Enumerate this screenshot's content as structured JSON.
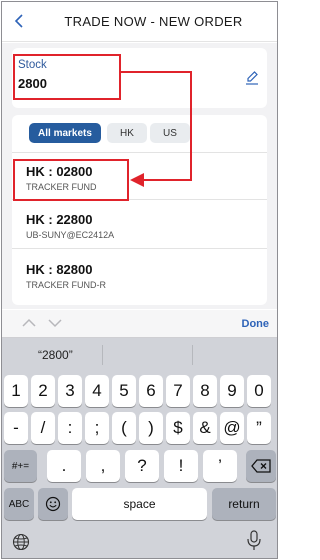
{
  "header": {
    "title": "TRADE NOW - NEW ORDER",
    "back_icon": "chevron-left-icon"
  },
  "stock_field": {
    "label": "Stock",
    "value": "2800",
    "edit_icon": "pencil-icon"
  },
  "market_filter": {
    "options": [
      "All markets",
      "HK",
      "US"
    ],
    "selected": "All markets"
  },
  "results": [
    {
      "code": "HK : 02800",
      "name": "TRACKER FUND"
    },
    {
      "code": "HK : 22800",
      "name": "UB-SUNY@EC2412A"
    },
    {
      "code": "HK : 82800",
      "name": "TRACKER FUND-R"
    }
  ],
  "keyboard": {
    "done_label": "Done",
    "suggestion": "“2800”",
    "row1": [
      "1",
      "2",
      "3",
      "4",
      "5",
      "6",
      "7",
      "8",
      "9",
      "0"
    ],
    "row2": [
      "-",
      "/",
      ":",
      ";",
      "(",
      ")",
      "$",
      "&",
      "@",
      "”"
    ],
    "row3": [
      ".",
      ",",
      "?",
      "!",
      "’"
    ],
    "symbols_label": "#+=",
    "abc_label": "ABC",
    "space_label": "space",
    "return_label": "return",
    "icons": [
      "emoji-icon",
      "backspace-icon",
      "globe-icon",
      "microphone-icon",
      "chevron-up-icon",
      "chevron-down-icon"
    ]
  },
  "colors": {
    "accent": "#265c9e",
    "annotation": "#e0232b",
    "link": "#2e63b8"
  }
}
